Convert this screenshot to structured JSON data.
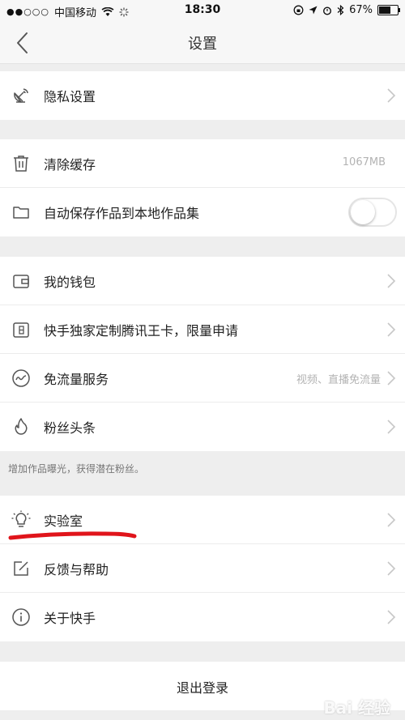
{
  "status_bar": {
    "carrier": "中国移动",
    "time": "18:30",
    "battery": "67%",
    "signal_dots": "●●○○○"
  },
  "nav": {
    "title": "设置"
  },
  "sections": {
    "privacy": {
      "label": "隐私设置"
    },
    "storage": {
      "clear_cache_label": "清除缓存",
      "clear_cache_size": "1067MB",
      "autosave_label": "自动保存作品到本地作品集",
      "autosave_on": false
    },
    "services": {
      "wallet_label": "我的钱包",
      "wangka_label": "快手独家定制腾讯王卡，限量申请",
      "free_data_label": "免流量服务",
      "free_data_value": "视频、直播免流量",
      "fans_label": "粉丝头条"
    },
    "fans_note": "增加作品曝光，获得潜在粉丝。",
    "misc": {
      "lab_label": "实验室",
      "feedback_label": "反馈与帮助",
      "about_label": "关于快手"
    },
    "logout_label": "退出登录"
  },
  "colors": {
    "annotation_red": "#e0141b",
    "chevron": "#c7c7c7",
    "icon": "#555555"
  },
  "watermark": "Bai 经验"
}
